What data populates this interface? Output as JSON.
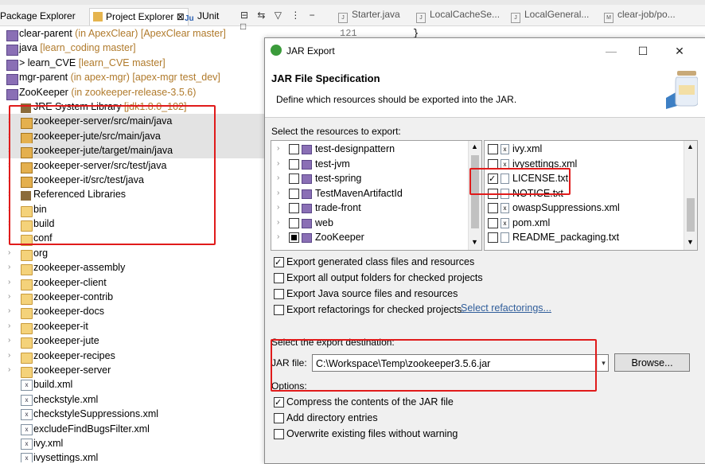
{
  "explorer": {
    "tabs": [
      {
        "label": "Package Explorer"
      },
      {
        "label": "Project Explorer ⊠"
      },
      {
        "label": "JUnit"
      }
    ],
    "rows": [
      {
        "name": "clear-parent",
        "deco": " (in ApexClear) [ApexClear master]"
      },
      {
        "name": "java",
        "deco": " [learn_coding master]"
      },
      {
        "name": "> learn_CVE",
        "deco": " [learn_CVE master]"
      },
      {
        "name": "mgr-parent",
        "deco": " (in apex-mgr) [apex-mgr test_dev]"
      },
      {
        "name": "ZooKeeper",
        "deco": " (in zookeeper-release-3.5.6)"
      },
      {
        "name": "JRE System Library",
        "deco": " [jdk1.8.0_102]"
      },
      {
        "name": "zookeeper-server/src/main/java",
        "deco": ""
      },
      {
        "name": "zookeeper-jute/src/main/java",
        "deco": ""
      },
      {
        "name": "zookeeper-jute/target/main/java",
        "deco": ""
      },
      {
        "name": "zookeeper-server/src/test/java",
        "deco": ""
      },
      {
        "name": "zookeeper-it/src/test/java",
        "deco": ""
      },
      {
        "name": "Referenced Libraries",
        "deco": ""
      },
      {
        "name": "bin",
        "deco": ""
      },
      {
        "name": "build",
        "deco": ""
      },
      {
        "name": "conf",
        "deco": ""
      },
      {
        "name": "org",
        "deco": ""
      },
      {
        "name": "zookeeper-assembly",
        "deco": ""
      },
      {
        "name": "zookeeper-client",
        "deco": ""
      },
      {
        "name": "zookeeper-contrib",
        "deco": ""
      },
      {
        "name": "zookeeper-docs",
        "deco": ""
      },
      {
        "name": "zookeeper-it",
        "deco": ""
      },
      {
        "name": "zookeeper-jute",
        "deco": ""
      },
      {
        "name": "zookeeper-recipes",
        "deco": ""
      },
      {
        "name": "zookeeper-server",
        "deco": ""
      },
      {
        "name": "build.xml",
        "deco": ""
      },
      {
        "name": "checkstyle.xml",
        "deco": ""
      },
      {
        "name": "checkstyleSuppressions.xml",
        "deco": ""
      },
      {
        "name": "excludeFindBugsFilter.xml",
        "deco": ""
      },
      {
        "name": "ivy.xml",
        "deco": ""
      },
      {
        "name": "ivysettings.xml",
        "deco": ""
      }
    ]
  },
  "editor": {
    "tabs": [
      "Starter.java",
      "LocalCacheSe...",
      "LocalGeneral...",
      "clear-job/po..."
    ],
    "line_number": "121",
    "line_code": "}"
  },
  "dialog": {
    "title": "JAR Export",
    "heading": "JAR File Specification",
    "description": "Define which resources should be exported into the JAR.",
    "resources_label": "Select the resources to export:",
    "left_items": [
      "test-designpattern",
      "test-jvm",
      "test-spring",
      "TestMavenArtifactId",
      "trade-front",
      "web",
      "ZooKeeper"
    ],
    "right_items": [
      "ivy.xml",
      "ivysettings.xml",
      "LICENSE.txt",
      "NOTICE.txt",
      "owaspSuppressions.xml",
      "pom.xml",
      "README_packaging.txt"
    ],
    "export_options": [
      {
        "label": "Export generated class files and resources",
        "checked": true
      },
      {
        "label": "Export all output folders for checked projects",
        "checked": false
      },
      {
        "label": "Export Java source files and resources",
        "checked": false
      },
      {
        "label": "Export refactorings for checked projects.",
        "checked": false
      }
    ],
    "select_refactorings": "Select refactorings...",
    "destination_label": "Select the export destination:",
    "jar_file_label": "JAR file:",
    "jar_file_value": "C:\\Workspace\\Temp\\zookeeper3.5.6.jar",
    "browse_label": "Browse...",
    "options_label": "Options:",
    "options": [
      {
        "label": "Compress the contents of the JAR file",
        "checked": true
      },
      {
        "label": "Add directory entries",
        "checked": false
      },
      {
        "label": "Overwrite existing files without warning",
        "checked": false
      }
    ]
  },
  "colors": {
    "highlight_box": "#e01b1b",
    "decoration": "#b07a2b"
  }
}
